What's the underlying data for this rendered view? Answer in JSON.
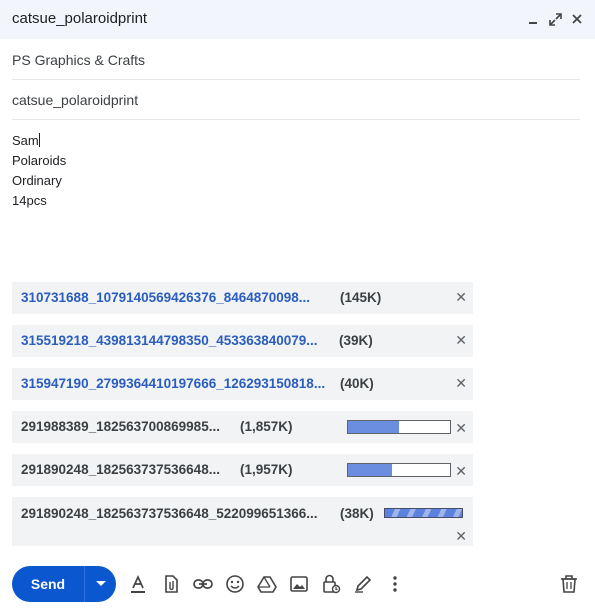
{
  "window": {
    "title": "catsue_polaroidprint"
  },
  "fields": {
    "recipients": "PS Graphics & Crafts",
    "subject": "catsue_polaroidprint"
  },
  "body": {
    "lines": [
      "Sam",
      "Polaroids",
      "Ordinary",
      "14pcs"
    ]
  },
  "attachments": [
    {
      "name": "310731688_1079140569426376_8464870098...",
      "size": "(145K)",
      "state": "uploaded"
    },
    {
      "name": "315519218_439813144798350_453363840079...",
      "size": "(39K)",
      "state": "uploaded"
    },
    {
      "name": "315947190_2799364410197666_126293150818...",
      "size": "(40K)",
      "state": "uploaded"
    },
    {
      "name": "291988389_182563700869985...",
      "size": "(1,857K)",
      "state": "uploading",
      "progress": 0.5
    },
    {
      "name": "291890248_182563737536648...",
      "size": "(1,957K)",
      "state": "uploading",
      "progress": 0.43
    },
    {
      "name": "291890248_182563737536648_522099651366...",
      "size": "(38K)",
      "state": "processing"
    }
  ],
  "toolbar": {
    "send_label": "Send",
    "tools": [
      "formatting-icon",
      "attach-file-icon",
      "insert-link-icon",
      "emoji-icon",
      "drive-icon",
      "insert-photo-icon",
      "confidential-mode-icon",
      "signature-icon",
      "more-options-icon"
    ],
    "discard": "delete-icon"
  },
  "colors": {
    "send": "#0b57d0",
    "link": "#2a5dbd",
    "progress": "#6c8ee0",
    "attachment_bg": "#f1f3f4",
    "header_bg": "#f2f6fc"
  }
}
